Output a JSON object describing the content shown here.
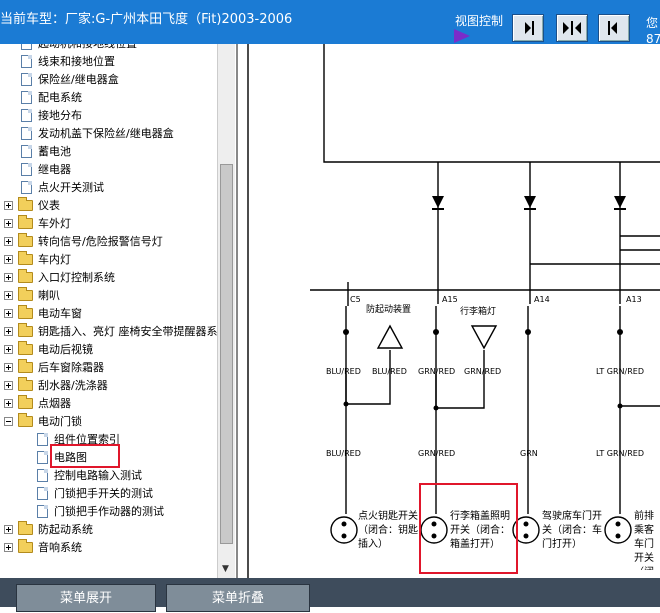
{
  "header": {
    "vehicle_text": "当前车型：厂家:G-广州本田飞度（Fit)2003-2006",
    "view_control_label": "视图控制",
    "extra_top": "您",
    "extra_bottom": "87"
  },
  "tree": {
    "items": [
      {
        "label": "起动机和接地线位置",
        "type": "doc",
        "level": 1
      },
      {
        "label": "线束和接地位置",
        "type": "doc",
        "level": 1
      },
      {
        "label": "保险丝/继电器盒",
        "type": "doc",
        "level": 1
      },
      {
        "label": "配电系统",
        "type": "doc",
        "level": 1
      },
      {
        "label": "接地分布",
        "type": "doc",
        "level": 1
      },
      {
        "label": "发动机盖下保险丝/继电器盒",
        "type": "doc",
        "level": 1
      },
      {
        "label": "蓄电池",
        "type": "doc",
        "level": 1
      },
      {
        "label": "继电器",
        "type": "doc",
        "level": 1
      },
      {
        "label": "点火开关测试",
        "type": "doc",
        "level": 1
      },
      {
        "label": "仪表",
        "type": "folder",
        "level": 0
      },
      {
        "label": "车外灯",
        "type": "folder",
        "level": 0
      },
      {
        "label": "转向信号/危险报警信号灯",
        "type": "folder",
        "level": 0
      },
      {
        "label": "车内灯",
        "type": "folder",
        "level": 0
      },
      {
        "label": "入口灯控制系统",
        "type": "folder",
        "level": 0
      },
      {
        "label": "喇叭",
        "type": "folder",
        "level": 0
      },
      {
        "label": "电动车窗",
        "type": "folder",
        "level": 0
      },
      {
        "label": "钥匙插入、亮灯 座椅安全带提醒器系",
        "type": "folder",
        "level": 0
      },
      {
        "label": "电动后视镜",
        "type": "folder",
        "level": 0
      },
      {
        "label": "后车窗除霜器",
        "type": "folder",
        "level": 0
      },
      {
        "label": "刮水器/洗涤器",
        "type": "folder",
        "level": 0
      },
      {
        "label": "点烟器",
        "type": "folder",
        "level": 0
      },
      {
        "label": "电动门锁",
        "type": "folder-open",
        "level": 0
      },
      {
        "label": "组件位置索引",
        "type": "doc",
        "level": 2
      },
      {
        "label": "电路图",
        "type": "doc",
        "level": 2
      },
      {
        "label": "控制电路输入测试",
        "type": "doc",
        "level": 2
      },
      {
        "label": "门锁把手开关的测试",
        "type": "doc",
        "level": 2
      },
      {
        "label": "门锁把手作动器的测试",
        "type": "doc",
        "level": 2
      },
      {
        "label": "防起动系统",
        "type": "folder",
        "level": 0
      },
      {
        "label": "音响系统",
        "type": "folder",
        "level": 0
      }
    ]
  },
  "diagram": {
    "pins": [
      "C5",
      "A15",
      "A14",
      "A13"
    ],
    "labels_top": [
      "防起动装置",
      "行李箱灯"
    ],
    "wires_upper": [
      "BLU/RED",
      "BLU/RED",
      "GRN/RED",
      "GRN/RED",
      "LT GRN/RED"
    ],
    "wires_lower": [
      "BLU/RED",
      "GRN/RED",
      "GRN",
      "LT GRN/RED"
    ],
    "switch_1": "点火钥匙开关（闭合：钥匙插入）",
    "switch_2": "行李箱盖照明开关（闭合：箱盖打开）",
    "switch_3": "驾驶席车门开关（闭合：车门打开）",
    "switch_4": "前排乘客车门开关（闭合）"
  },
  "buttons": {
    "expand": "菜单展开",
    "collapse": "菜单折叠"
  }
}
